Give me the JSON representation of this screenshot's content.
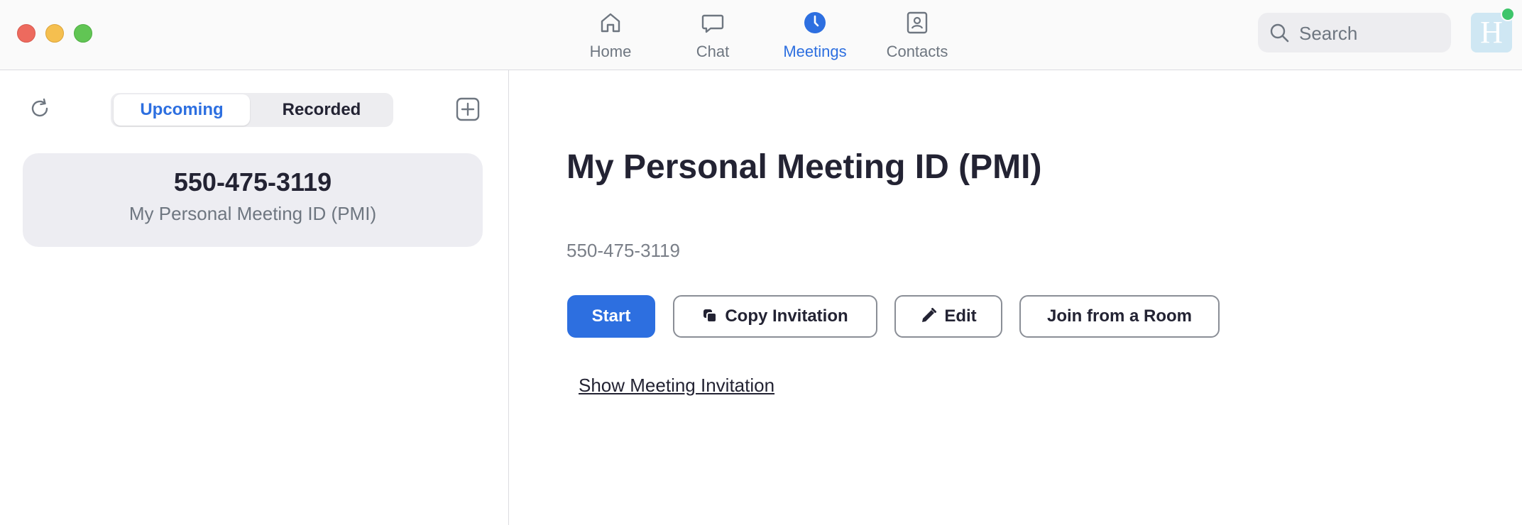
{
  "window": {
    "controls": [
      "close",
      "minimize",
      "zoom"
    ]
  },
  "nav": {
    "tabs": [
      {
        "label": "Home",
        "icon": "home-icon",
        "active": false
      },
      {
        "label": "Chat",
        "icon": "chat-bubble-icon",
        "active": false
      },
      {
        "label": "Meetings",
        "icon": "clock-icon",
        "active": true
      },
      {
        "label": "Contacts",
        "icon": "contact-card-icon",
        "active": false
      }
    ]
  },
  "search": {
    "placeholder": "Search",
    "value": ""
  },
  "profile": {
    "avatar_letter": "H",
    "status": "online",
    "status_color": "#3ec56a"
  },
  "sidebar": {
    "segments": {
      "upcoming": "Upcoming",
      "recorded": "Recorded",
      "selected": "Upcoming"
    },
    "meetings": [
      {
        "id": "550-475-3119",
        "name": "My Personal Meeting ID (PMI)"
      }
    ]
  },
  "main": {
    "title": "My Personal Meeting ID (PMI)",
    "meeting_id": "550-475-3119",
    "buttons": {
      "start": "Start",
      "copy_invitation": "Copy Invitation",
      "edit": "Edit",
      "join_room": "Join from a Room"
    },
    "show_invitation_link": "Show Meeting Invitation"
  },
  "colors": {
    "accent": "#2d6fe0",
    "text": "#232333",
    "muted": "#6e7680"
  }
}
